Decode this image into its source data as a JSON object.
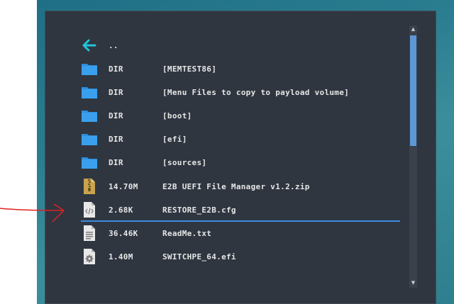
{
  "files": [
    {
      "icon": "back-arrow-icon",
      "size": "..",
      "name": ""
    },
    {
      "icon": "folder-icon",
      "size": "DIR",
      "name": "[MEMTEST86]"
    },
    {
      "icon": "folder-icon",
      "size": "DIR",
      "name": "[Menu Files to copy to payload volume]"
    },
    {
      "icon": "folder-icon",
      "size": "DIR",
      "name": "[boot]"
    },
    {
      "icon": "folder-icon",
      "size": "DIR",
      "name": "[efi]"
    },
    {
      "icon": "folder-icon",
      "size": "DIR",
      "name": "[sources]"
    },
    {
      "icon": "zip-archive-icon",
      "size": "14.70M",
      "name": "E2B UEFI File Manager v1.2.zip"
    },
    {
      "icon": "config-file-icon",
      "size": "2.68K",
      "name": "RESTORE_E2B.cfg"
    },
    {
      "icon": "text-file-icon",
      "size": "36.46K",
      "name": "ReadMe.txt"
    },
    {
      "icon": "efi-file-icon",
      "size": "1.40M",
      "name": "SWITCHPE_64.efi"
    }
  ],
  "selected_index": 7,
  "colors": {
    "panel": "#2f3640",
    "accent": "#3d8be0",
    "folder": "#2d8fe0",
    "back_arrow": "#20c4d8",
    "annotation": "#e02020"
  }
}
